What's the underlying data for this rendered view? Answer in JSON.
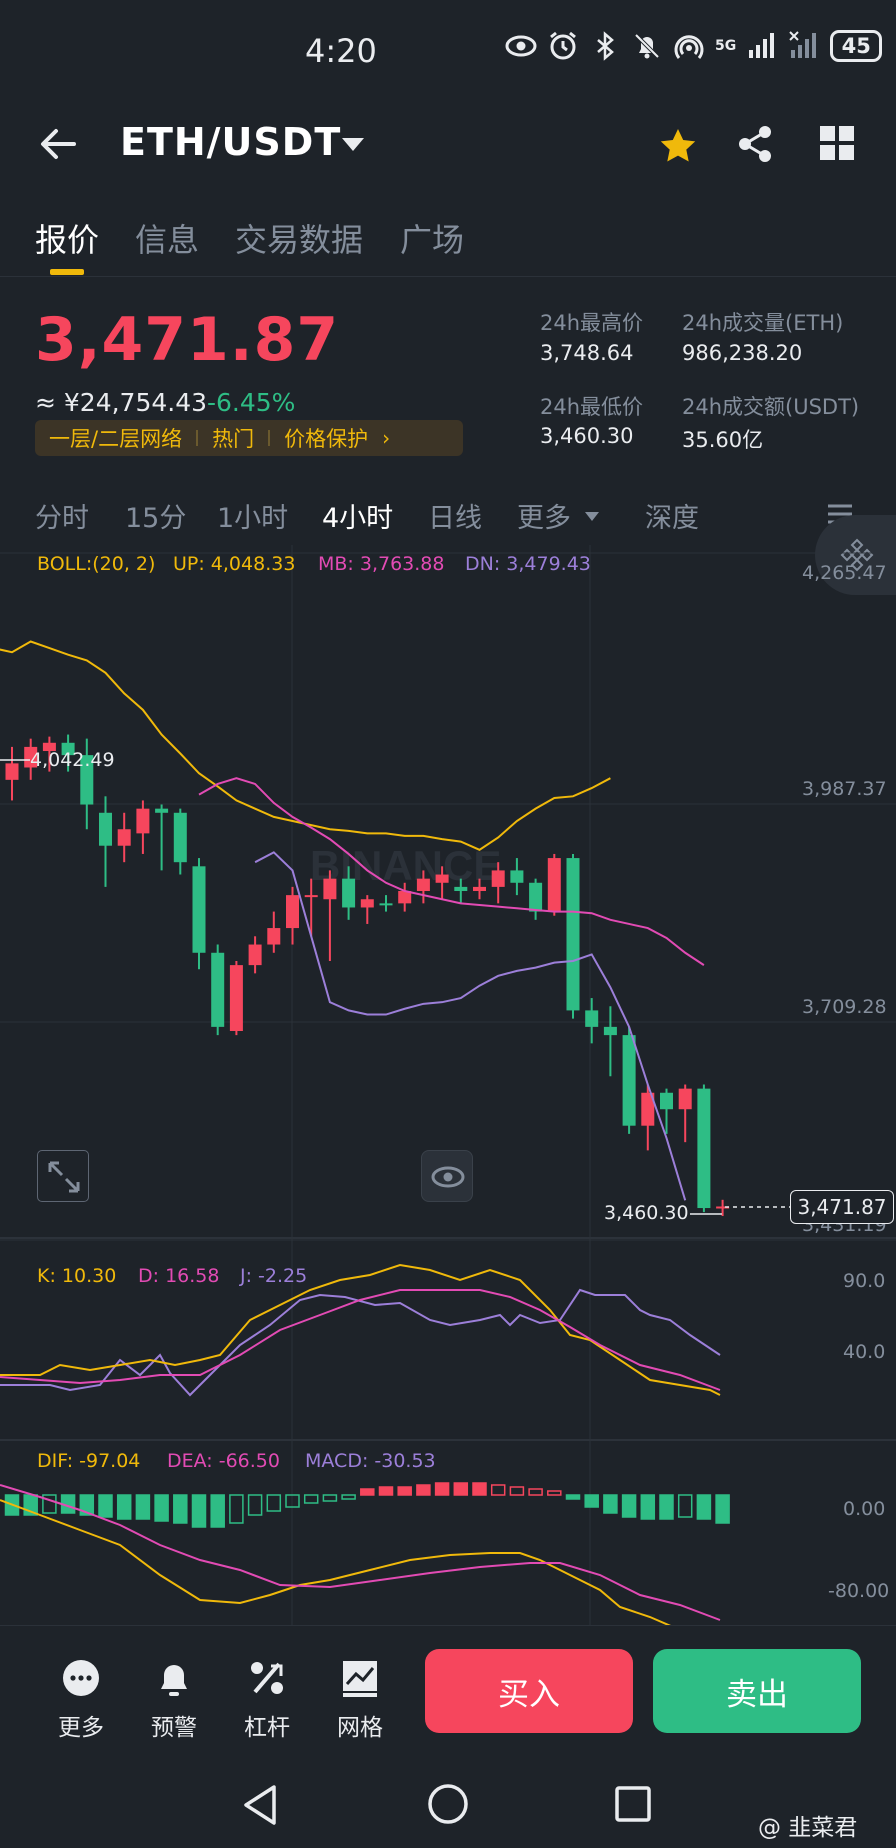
{
  "status_bar": {
    "time": "4:20",
    "battery": "45",
    "network": "5G",
    "icons": [
      "eye-icon",
      "alarm-icon",
      "bluetooth-icon",
      "bell-off-icon",
      "hotspot-icon",
      "signal-icon",
      "signal-icon-2",
      "battery-icon"
    ]
  },
  "header": {
    "pair": "ETH/USDT",
    "icons": [
      "back-arrow-icon",
      "star-icon",
      "share-icon",
      "grid-icon"
    ],
    "star_color": "#f0b90b"
  },
  "main_tabs": [
    "报价",
    "信息",
    "交易数据",
    "广场"
  ],
  "active_main_tab": "报价",
  "price": {
    "last": "3,471.87",
    "cny": "≈ ¥24,754.43",
    "change": "-6.45%",
    "up_color": "#2ebd85",
    "down_color": "#f6465d"
  },
  "tags": [
    "一层/二层网络",
    "热门",
    "价格保护"
  ],
  "stats": {
    "high_label": "24h最高价",
    "high": "3,748.64",
    "low_label": "24h最低价",
    "low": "3,460.30",
    "vol_eth_label": "24h成交量(ETH)",
    "vol_eth": "986,238.20",
    "vol_usdt_label": "24h成交额(USDT)",
    "vol_usdt": "35.60亿"
  },
  "period_tabs": [
    "分时",
    "15分",
    "1小时",
    "4小时",
    "日线",
    "更多",
    "深度"
  ],
  "active_period": "4小时",
  "boll": {
    "label": "BOLL:(20, 2)",
    "up": "UP: 4,048.33",
    "mb": "MB: 3,763.88",
    "dn": "DN: 3,479.43"
  },
  "price_axis": [
    "4,265.47",
    "3,987.37",
    "3,709.28",
    "3,431.19"
  ],
  "chart_marks": {
    "high_mark": "4,042.49",
    "low_mark": "3,460.30",
    "last_price_box": "3,471.87"
  },
  "kdj": {
    "k": "K: 10.30",
    "d": "D: 16.58",
    "j": "J: -2.25",
    "axis": [
      "90.0",
      "40.0"
    ]
  },
  "macd": {
    "dif": "DIF: -97.04",
    "dea": "DEA: -66.50",
    "macd": "MACD: -30.53",
    "axis": [
      "0.00",
      "-80.00"
    ]
  },
  "bottom_actions": [
    "更多",
    "预警",
    "杠杆",
    "网格"
  ],
  "buy_label": "买入",
  "sell_label": "卖出",
  "nav_icons": [
    "back-triangle-icon",
    "home-circle-icon",
    "recent-square-icon"
  ],
  "watermark": "@ 韭菜君",
  "colors": {
    "bg": "#1e2329",
    "yellow": "#f0b90b",
    "pink": "#e24bb4",
    "purple": "#9c7fd9",
    "muted": "#848e9c"
  },
  "chart_data": {
    "type": "candlestick",
    "timeframe": "4小时",
    "ylim": [
      3431.19,
      4265.47
    ],
    "candles": [
      {
        "o": 3990,
        "h": 4030,
        "l": 3965,
        "c": 4010
      },
      {
        "o": 4005,
        "h": 4040,
        "l": 3990,
        "c": 4030
      },
      {
        "o": 4025,
        "h": 4042.49,
        "l": 4000,
        "c": 4035
      },
      {
        "o": 4035,
        "h": 4045,
        "l": 4000,
        "c": 4020
      },
      {
        "o": 4020,
        "h": 4040,
        "l": 3930,
        "c": 3960
      },
      {
        "o": 3950,
        "h": 3970,
        "l": 3860,
        "c": 3910
      },
      {
        "o": 3910,
        "h": 3950,
        "l": 3890,
        "c": 3930
      },
      {
        "o": 3925,
        "h": 3965,
        "l": 3900,
        "c": 3955
      },
      {
        "o": 3955,
        "h": 3960,
        "l": 3880,
        "c": 3950
      },
      {
        "o": 3950,
        "h": 3955,
        "l": 3875,
        "c": 3890
      },
      {
        "o": 3885,
        "h": 3895,
        "l": 3760,
        "c": 3780
      },
      {
        "o": 3780,
        "h": 3790,
        "l": 3680,
        "c": 3690
      },
      {
        "o": 3685,
        "h": 3770,
        "l": 3680,
        "c": 3765
      },
      {
        "o": 3765,
        "h": 3800,
        "l": 3755,
        "c": 3790
      },
      {
        "o": 3790,
        "h": 3830,
        "l": 3780,
        "c": 3810
      },
      {
        "o": 3810,
        "h": 3860,
        "l": 3790,
        "c": 3850
      },
      {
        "o": 3850,
        "h": 3870,
        "l": 3800,
        "c": 3850
      },
      {
        "o": 3845,
        "h": 3880,
        "l": 3770,
        "c": 3870
      },
      {
        "o": 3870,
        "h": 3885,
        "l": 3820,
        "c": 3835
      },
      {
        "o": 3835,
        "h": 3850,
        "l": 3815,
        "c": 3845
      },
      {
        "o": 3840,
        "h": 3850,
        "l": 3830,
        "c": 3838
      },
      {
        "o": 3840,
        "h": 3865,
        "l": 3830,
        "c": 3855
      },
      {
        "o": 3855,
        "h": 3880,
        "l": 3840,
        "c": 3870
      },
      {
        "o": 3865,
        "h": 3885,
        "l": 3845,
        "c": 3875
      },
      {
        "o": 3860,
        "h": 3870,
        "l": 3840,
        "c": 3855
      },
      {
        "o": 3855,
        "h": 3870,
        "l": 3845,
        "c": 3860
      },
      {
        "o": 3860,
        "h": 3890,
        "l": 3840,
        "c": 3880
      },
      {
        "o": 3880,
        "h": 3895,
        "l": 3850,
        "c": 3865
      },
      {
        "o": 3865,
        "h": 3870,
        "l": 3820,
        "c": 3830
      },
      {
        "o": 3830,
        "h": 3900,
        "l": 3825,
        "c": 3895
      },
      {
        "o": 3895,
        "h": 3900,
        "l": 3700,
        "c": 3710
      },
      {
        "o": 3710,
        "h": 3725,
        "l": 3670,
        "c": 3690
      },
      {
        "o": 3690,
        "h": 3715,
        "l": 3630,
        "c": 3680
      },
      {
        "o": 3680,
        "h": 3690,
        "l": 3560,
        "c": 3570
      },
      {
        "o": 3570,
        "h": 3620,
        "l": 3540,
        "c": 3610
      },
      {
        "o": 3610,
        "h": 3615,
        "l": 3560,
        "c": 3590
      },
      {
        "o": 3590,
        "h": 3620,
        "l": 3550,
        "c": 3615
      },
      {
        "o": 3615,
        "h": 3620,
        "l": 3465,
        "c": 3470
      },
      {
        "o": 3470,
        "h": 3480,
        "l": 3460.3,
        "c": 3471.87
      }
    ],
    "boll_up": [
      4150,
      4145,
      4158,
      4150,
      4142,
      4135,
      4120,
      4095,
      4075,
      4045,
      4022,
      3998,
      3982,
      3965,
      3955,
      3945,
      3940,
      3935,
      3930,
      3928,
      3925,
      3925,
      3922,
      3922,
      3918,
      3915,
      3905,
      3920,
      3940,
      3955,
      3968,
      3970,
      3980,
      3992
    ],
    "boll_mb": [
      3972,
      3985,
      3992,
      3985,
      3962,
      3945,
      3932,
      3918,
      3900,
      3880,
      3865,
      3855,
      3850,
      3845,
      3840,
      3838,
      3836,
      3834,
      3832,
      3830,
      3830,
      3828,
      3820,
      3815,
      3810,
      3798,
      3780,
      3765
    ],
    "boll_dn": [
      3890,
      3902,
      3880,
      3800,
      3720,
      3710,
      3705,
      3705,
      3712,
      3718,
      3720,
      3725,
      3740,
      3752,
      3758,
      3762,
      3768,
      3770,
      3778,
      3738,
      3690,
      3620,
      3555,
      3479.43
    ],
    "kdj": {
      "k": 10.3,
      "d": 16.58,
      "j": -2.25
    },
    "macd": {
      "dif": -97.04,
      "dea": -66.5,
      "macd": -30.53
    }
  }
}
